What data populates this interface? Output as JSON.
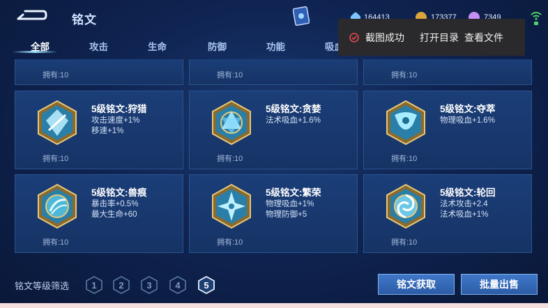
{
  "header": {
    "title": "铭文"
  },
  "currencies": [
    {
      "name": "diamond",
      "value": "164413",
      "color": "#8fd1ff"
    },
    {
      "name": "gold",
      "value": "173377",
      "color": "#e6b64a"
    },
    {
      "name": "crystal",
      "value": "7349",
      "color": "#d9a0ff"
    }
  ],
  "tabs": [
    "全部",
    "攻击",
    "生命",
    "防御",
    "功能",
    "吸血"
  ],
  "active_tab": "全部",
  "toast": {
    "message": "截图成功",
    "open_dir": "打开目录",
    "view_file": "查看文件",
    "icon_color": "#e5484d"
  },
  "top_row": [
    {
      "owned": "拥有:10"
    },
    {
      "owned": "拥有:10"
    },
    {
      "owned": "拥有:10"
    }
  ],
  "runes": [
    {
      "name": "5级铭文:狩猎",
      "attrs": [
        "攻击速度+1%",
        "移速+1%"
      ],
      "owned": "拥有:10",
      "icon": "hunt-rune-icon"
    },
    {
      "name": "5级铭文:贪婪",
      "attrs": [
        "法术吸血+1.6%"
      ],
      "owned": "拥有:10",
      "icon": "greed-rune-icon"
    },
    {
      "name": "5级铭文:夺萃",
      "attrs": [
        "物理吸血+1.6%"
      ],
      "owned": "拥有:10",
      "icon": "plunder-rune-icon"
    },
    {
      "name": "5级铭文:兽痕",
      "attrs": [
        "暴击率+0.5%",
        "最大生命+60"
      ],
      "owned": "拥有:10",
      "icon": "beast-mark-rune-icon"
    },
    {
      "name": "5级铭文:繁荣",
      "attrs": [
        "物理吸血+1%",
        "物理防御+5"
      ],
      "owned": "拥有:10",
      "icon": "prosperity-rune-icon"
    },
    {
      "name": "5级铭文:轮回",
      "attrs": [
        "法术攻击+2.4",
        "法术吸血+1%"
      ],
      "owned": "拥有:10",
      "icon": "reincarnation-rune-icon"
    }
  ],
  "filter": {
    "label": "铭文等级筛选",
    "levels": [
      "1",
      "2",
      "3",
      "4",
      "5"
    ],
    "selected": "5"
  },
  "buttons": {
    "acquire": "铭文获取",
    "bulk_sell": "批量出售"
  },
  "colors": {
    "accent": "#3f77c8",
    "card_bg": "#1b3e78"
  }
}
